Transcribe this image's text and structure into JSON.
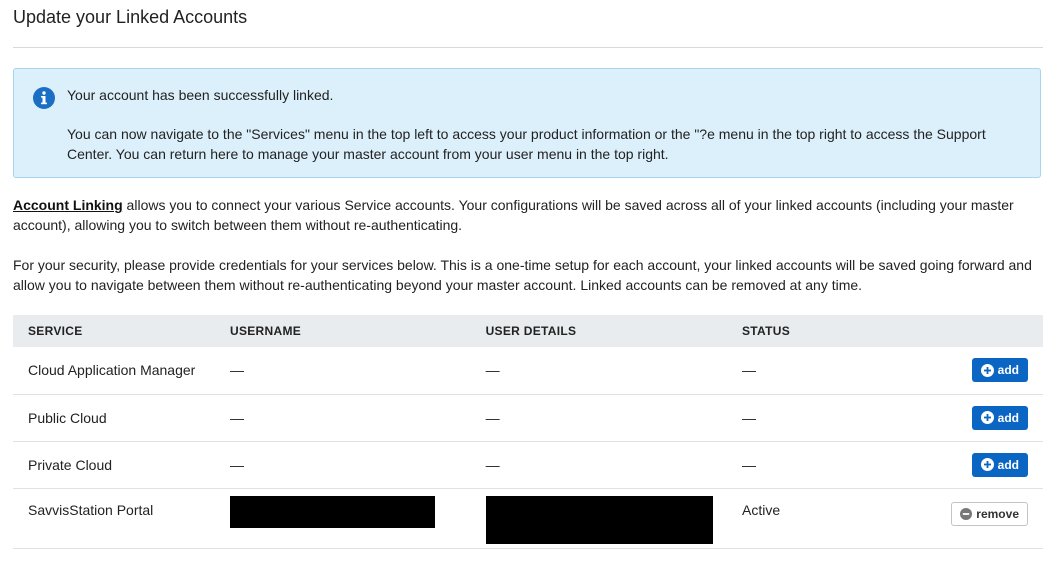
{
  "page": {
    "title": "Update your Linked Accounts"
  },
  "alert": {
    "icon": "info-circle-icon",
    "line1": "Your account has been successfully linked.",
    "body": "You can now navigate to the \"Services\" menu in the top left to access your product information or the \"?e menu in the top right to access the Support Center. You can return here to manage your master account from your user menu in the top right.",
    "colors": {
      "background": "#dcf0fb",
      "border": "#a7d4ee",
      "icon": "#1a6fc4"
    }
  },
  "intro": {
    "link_text": "Account Linking",
    "p1_rest": " allows you to connect your various Service accounts. Your configurations will be saved across all of your linked accounts (including your master account), allowing you to switch between them without re-authenticating.",
    "p2": "For your security, please provide credentials for your services below. This is a one-time setup for each account, your linked accounts will be saved going forward and allow you to navigate between them without re-authenticating beyond your master account. Linked accounts can be removed at any time."
  },
  "table": {
    "headers": [
      "SERVICE",
      "USERNAME",
      "USER DETAILS",
      "STATUS"
    ],
    "rows": [
      {
        "service": "Cloud Application Manager",
        "username": "—",
        "user_details": "—",
        "status": "—",
        "action": "add"
      },
      {
        "service": "Public Cloud",
        "username": "—",
        "user_details": "—",
        "status": "—",
        "action": "add"
      },
      {
        "service": "Private Cloud",
        "username": "—",
        "user_details": "—",
        "status": "—",
        "action": "add"
      },
      {
        "service": "SavvisStation Portal",
        "username": "",
        "user_details": "",
        "status": "Active",
        "action": "remove"
      }
    ]
  },
  "colors": {
    "accent": "#0b65c3",
    "header_bg": "#e9ecef"
  }
}
